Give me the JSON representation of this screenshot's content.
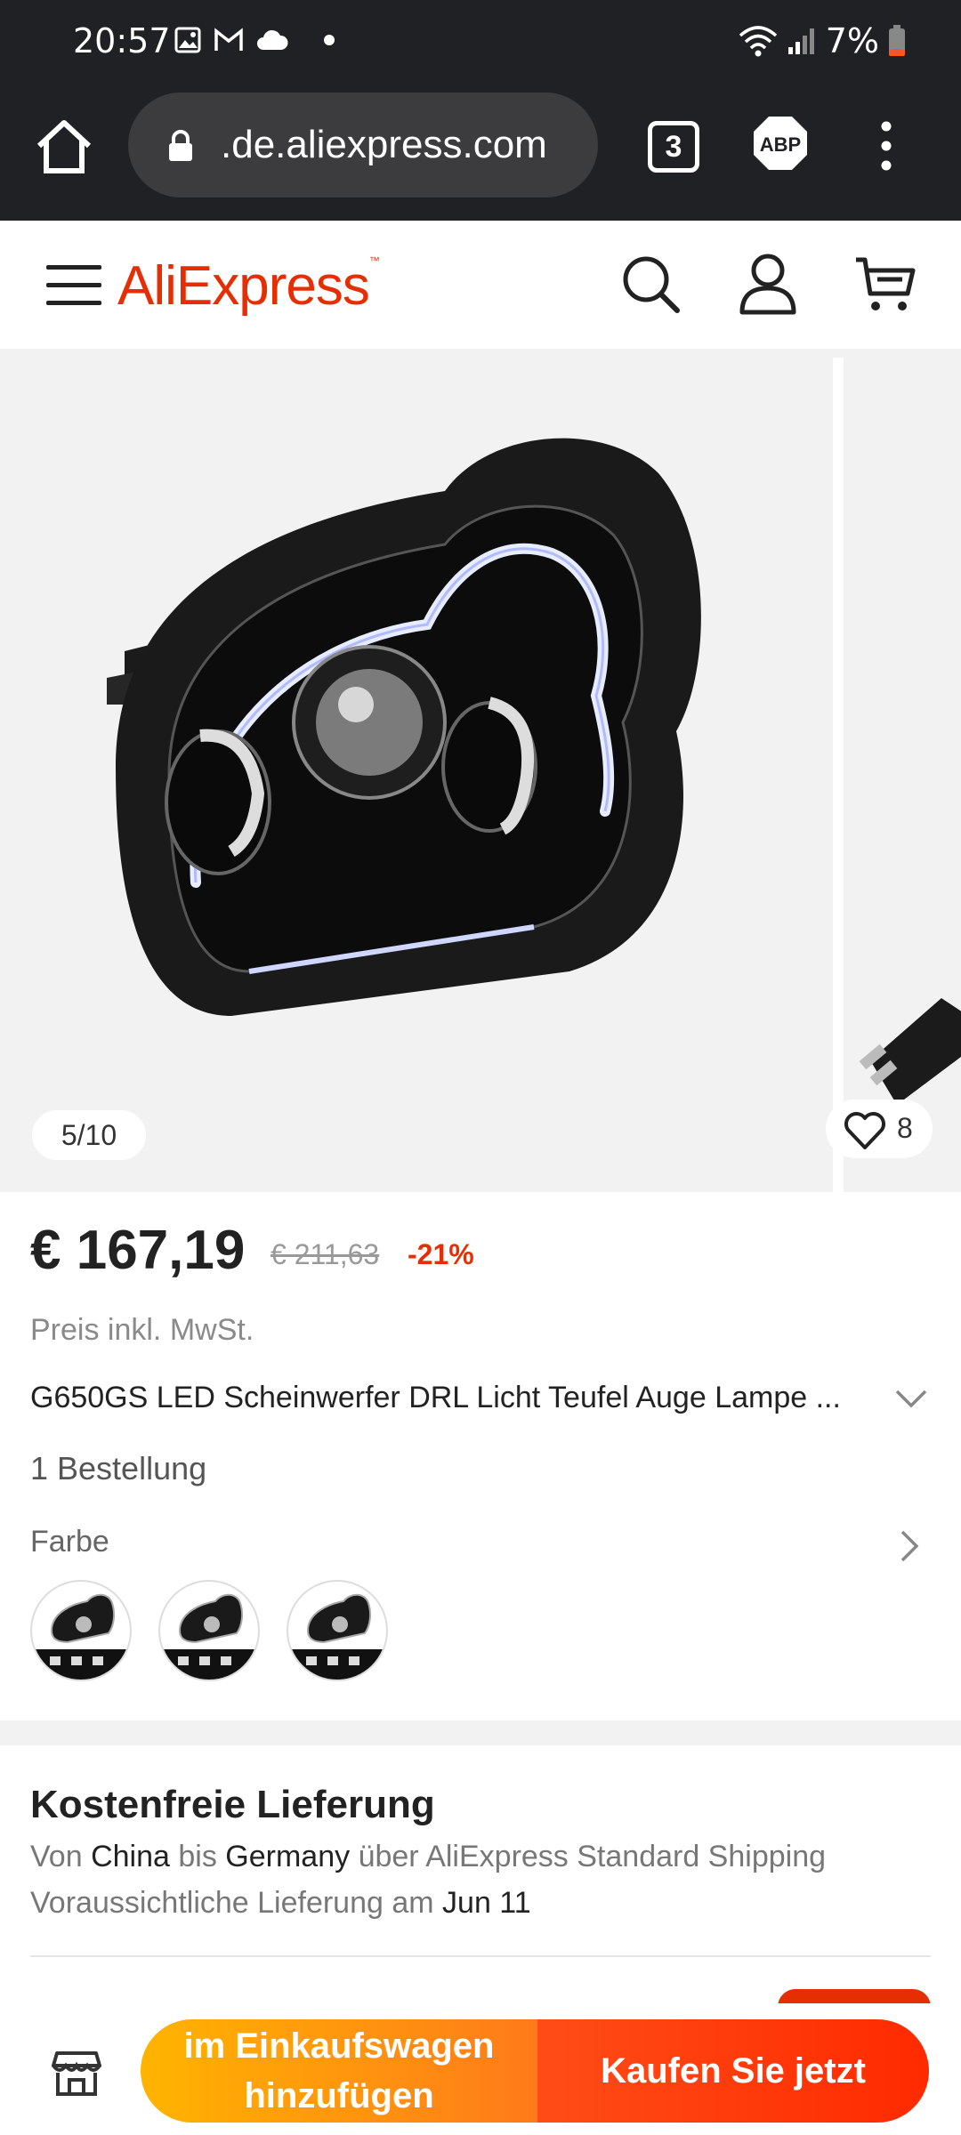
{
  "status_bar": {
    "time": "20:57",
    "icons": [
      "image-icon",
      "gmail-icon",
      "cloud-icon",
      "dot-icon"
    ],
    "right_icons": [
      "wifi-icon",
      "signal-icon"
    ],
    "battery": "7%"
  },
  "browser": {
    "url": ".de.aliexpress.com",
    "tab_count": "3",
    "adblock_label": "ABP"
  },
  "site": {
    "logo": "AliExpress"
  },
  "gallery": {
    "counter": "5/10",
    "likes": "8"
  },
  "product": {
    "price": "€ 167,19",
    "old_price": "€ 211,63",
    "discount": "-21%",
    "tax_note": "Preis inkl. MwSt.",
    "title": "G650GS LED Scheinwerfer DRL Licht Teufel Auge Lampe ...",
    "orders": "1 Bestellung",
    "color_label": "Farbe",
    "swatch_count": 3
  },
  "delivery": {
    "title": "Kostenfreie Lieferung",
    "from_label": "Von",
    "from": "China",
    "to_label": "bis",
    "to": "Germany",
    "via": "über AliExpress Standard Shipping",
    "eta_label": "Voraussichtliche Lieferung am",
    "eta": "Jun 11"
  },
  "bottom_bar": {
    "add_to_cart_line1": "im Einkaufswagen",
    "add_to_cart_line2": "hinzufügen",
    "buy_now": "Kaufen Sie jetzt"
  },
  "colors": {
    "brand": "#e62e04",
    "status_bar_bg": "#202124",
    "cart_button": "#ff9a00",
    "buy_button": "#ff3300"
  }
}
